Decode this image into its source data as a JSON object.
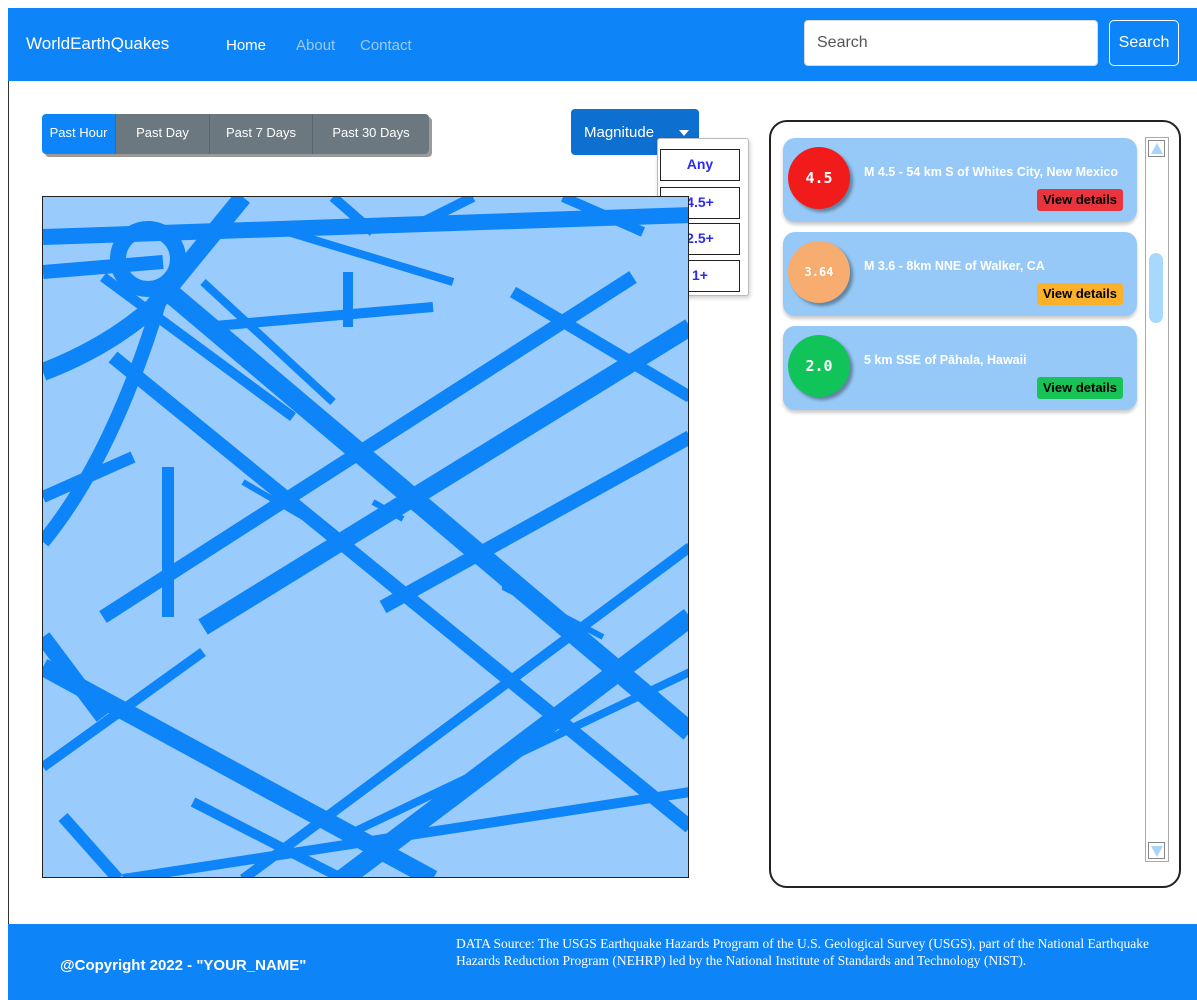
{
  "nav": {
    "brand": "WorldEarthQuakes",
    "links": [
      {
        "label": "Home",
        "color": "#ffffff"
      },
      {
        "label": "About",
        "color": "#9ec9f5"
      },
      {
        "label": "Contact",
        "color": "#9ec9f5"
      }
    ],
    "search_placeholder": "Search",
    "search_button": "Search"
  },
  "time_filters": [
    {
      "label": "Past Hour",
      "active": true
    },
    {
      "label": "Past Day",
      "active": false
    },
    {
      "label": "Past 7 Days",
      "active": false
    },
    {
      "label": "Past 30 Days",
      "active": false
    }
  ],
  "magnitude": {
    "label": "Magnitude",
    "options": [
      "Any",
      "4.5+",
      "2.5+",
      "1+"
    ]
  },
  "quakes": [
    {
      "magnitude": "4.5",
      "title": "M 4.5 - 54 km S of Whites City, New Mexico",
      "details": "View details",
      "circle_color": "#f21b1b",
      "button_color": "#e8343d"
    },
    {
      "magnitude": "3.64",
      "title": "M 3.6 - 8km NNE of Walker, CA",
      "details": "View details",
      "circle_color": "#f7ad6f",
      "button_color": "#fbb129"
    },
    {
      "magnitude": "2.0",
      "title": "5 km SSE of Pāhala, Hawaii",
      "details": "View details",
      "circle_color": "#11c45a",
      "button_color": "#16c354"
    }
  ],
  "footer": {
    "copyright": "@Copyright 2022 - \"YOUR_NAME\"",
    "data_source": "DATA Source: The USGS Earthquake Hazards Program of the U.S. Geological Survey (USGS), part of the National Earthquake Hazards Reduction Program (NEHRP) led by the National Institute of Standards and Technology (NIST)."
  },
  "colors": {
    "primary": "#0d84f7",
    "map_land": "#99ccfc",
    "map_road": "#0d84f7"
  }
}
